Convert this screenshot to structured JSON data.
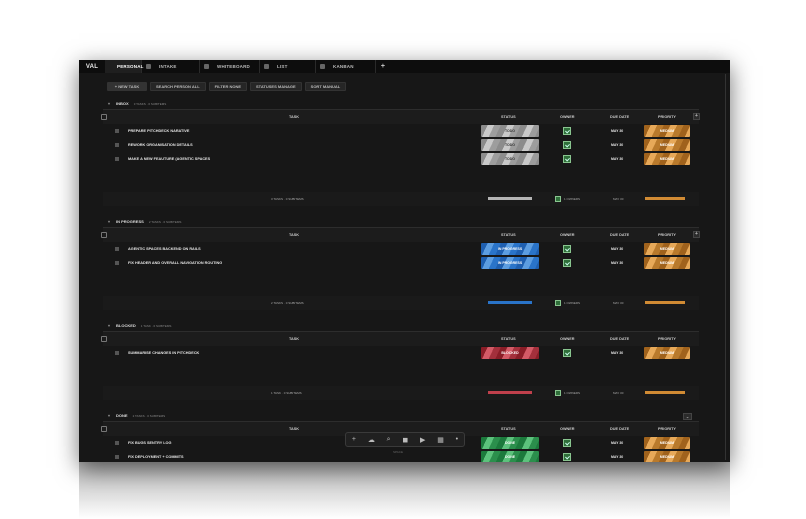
{
  "app": {
    "logo": "VAL"
  },
  "tabs": [
    {
      "label": "PERSONAL"
    },
    {
      "label": "INTAKE"
    },
    {
      "label": "WHITEBOARD"
    },
    {
      "label": "LIST"
    },
    {
      "label": "KANBAN"
    }
  ],
  "toolbar": {
    "new_task": "+ NEW TASK",
    "search": "SEARCH PERSON ALL",
    "filter": "FILTER NONE",
    "statuses": "STATUSES MANAGE",
    "sort": "SORT MANUAL"
  },
  "columns": {
    "task": "TASK",
    "status": "STATUS",
    "owner": "OWNER",
    "due": "DUE DATE",
    "priority": "PRIORITY"
  },
  "groups": [
    {
      "name": "INBOX",
      "count": "3 TASKS · 0 SUBITEMS",
      "rows": [
        {
          "task": "PREPARE PITCHDECK NARATIVE",
          "status": "TODO",
          "due": "MAY 30",
          "priority": "MEDIUM"
        },
        {
          "task": "REWORK ORGANISATION DETAILS",
          "status": "TODO",
          "due": "MAY 30",
          "priority": "MEDIUM"
        },
        {
          "task": "MAKE A NEW FEAUTURE (AGENTIC SPACES",
          "status": "TODO",
          "due": "MAY 30",
          "priority": "MEDIUM"
        }
      ],
      "summary": {
        "count": "3 TASKS · 0 SUBITEMS",
        "owners": "1 OWNERS",
        "due": "MAY 30"
      }
    },
    {
      "name": "IN PROGRESS",
      "count": "2 TASKS · 0 SUBITEMS",
      "rows": [
        {
          "task": "AGENTIC SPACES BACKEND ON RAILS",
          "status": "IN PROGRESS",
          "due": "MAY 30",
          "priority": "MEDIUM"
        },
        {
          "task": "FIX HEADER AND OVERALL NAVIGATION ROUTING",
          "status": "IN PROGRESS",
          "due": "MAY 30",
          "priority": "MEDIUM"
        }
      ],
      "summary": {
        "count": "2 TASKS · 0 SUBITEMS",
        "owners": "1 OWNERS",
        "due": "MAY 30"
      }
    },
    {
      "name": "BLOCKED",
      "count": "1 TASK · 0 SUBITEMS",
      "rows": [
        {
          "task": "SUMMARISE CHANGES IN PITCHDECK",
          "status": "BLOCKED",
          "due": "MAY 30",
          "priority": "MEDIUM"
        }
      ],
      "summary": {
        "count": "1 TASK · 0 SUBITEMS",
        "owners": "1 OWNERS",
        "due": "MAY 30"
      }
    },
    {
      "name": "DONE",
      "count": "2 TASKS · 0 SUBITEMS",
      "rows": [
        {
          "task": "FIX BUGS SENTRY LOG",
          "status": "DONE",
          "due": "MAY 30",
          "priority": "MEDIUM"
        },
        {
          "task": "FIX DEPLOYMENT + COMMITS",
          "status": "DONE",
          "due": "MAY 30",
          "priority": "MEDIUM"
        }
      ]
    }
  ],
  "colors": {
    "todo": "#b5b5b5",
    "in_progress": "#2a74c9",
    "blocked": "#c0404c",
    "done": "#2b8f4c",
    "medium": "#d18b34"
  },
  "dock": {
    "icons": [
      "plus-icon",
      "cloud-icon",
      "search-icon",
      "camera-icon",
      "play-icon",
      "grid-icon",
      "dot-icon"
    ],
    "label": "SPACE"
  }
}
